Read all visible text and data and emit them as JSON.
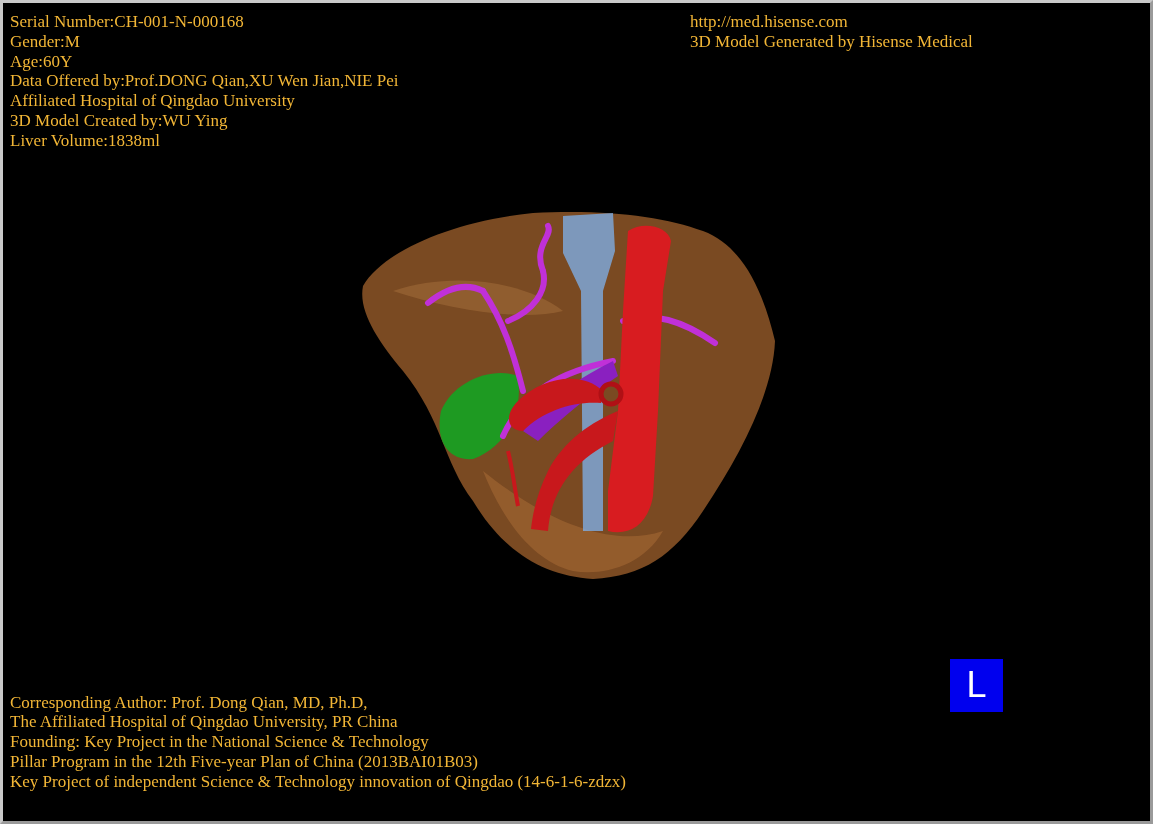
{
  "info_left": [
    "Serial Number:CH-001-N-000168",
    "Gender:M",
    "Age:60Y",
    "Data Offered by:Prof.DONG Qian,XU Wen Jian,NIE Pei",
    "Affiliated Hospital of Qingdao University",
    "3D Model Created by:WU Ying",
    "Liver Volume:1838ml"
  ],
  "info_right": [
    "http://med.hisense.com",
    "3D Model Generated by Hisense Medical"
  ],
  "credits": [
    "Corresponding Author: Prof. Dong Qian, MD, Ph.D,",
    "The Affiliated Hospital of Qingdao University, PR China",
    "Founding: Key Project in the National Science & Technology",
    "Pillar Program in the 12th Five-year Plan of China (2013BAI01B03)",
    "Key Project of independent Science & Technology innovation of Qingdao (14-6-1-6-zdzx)"
  ],
  "orientation_marker": "L"
}
